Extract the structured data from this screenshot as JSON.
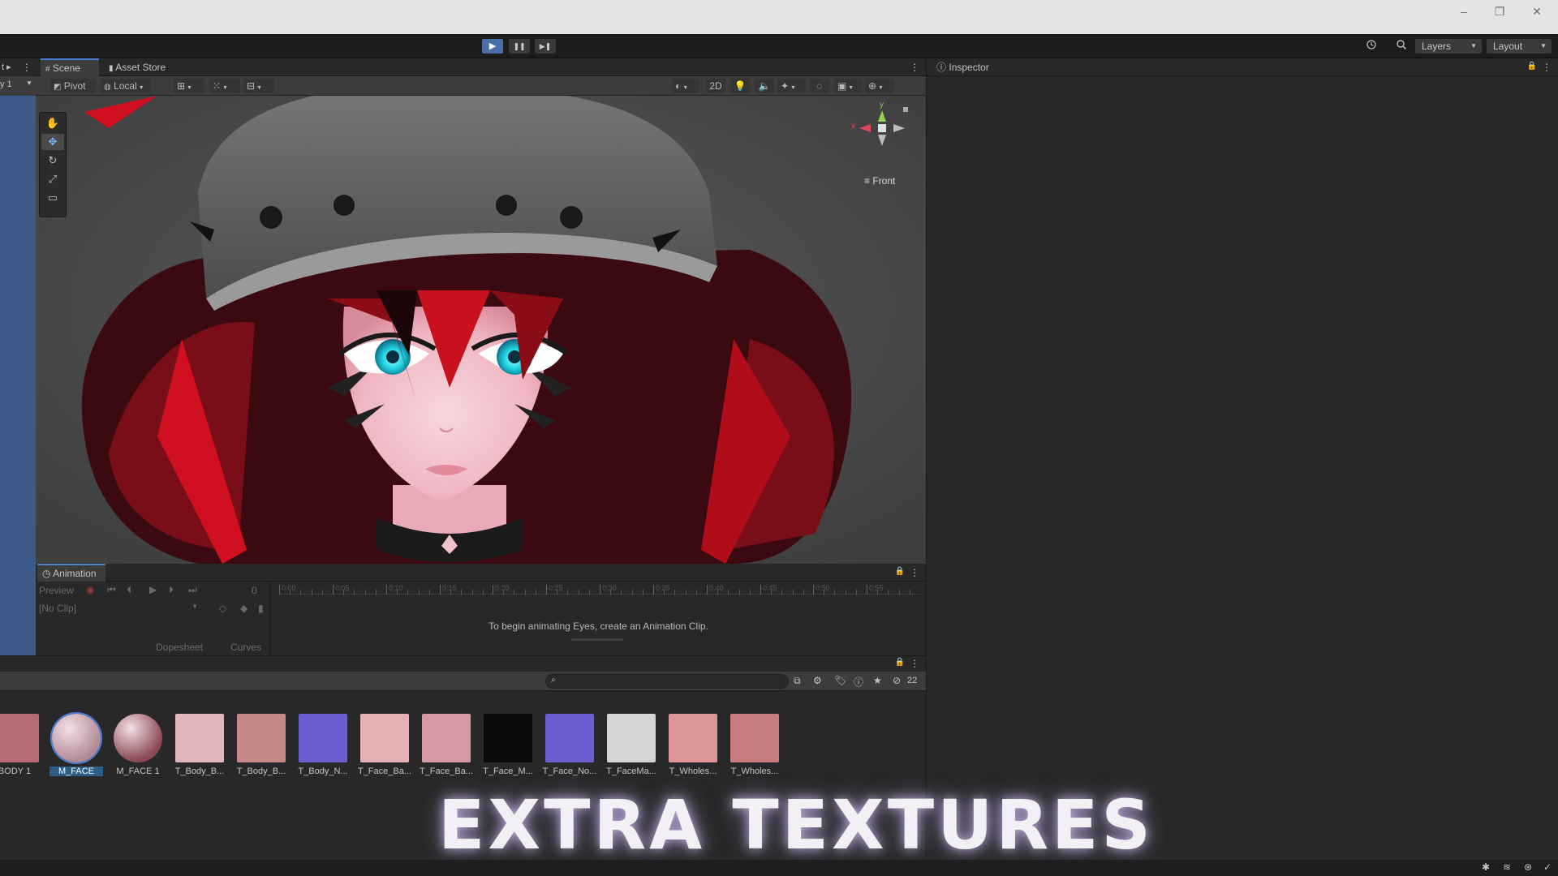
{
  "titlebar": {
    "minimize": "–",
    "maximize": "❐",
    "close": "✕"
  },
  "toolbar": {
    "play": "▶",
    "pause": "❚❚",
    "step": "▶❚",
    "history_icon": "history-icon",
    "search_icon": "search-icon",
    "layers_label": "Layers",
    "layout_label": "Layout"
  },
  "left_stub": {
    "label_top": "t ▸",
    "label_row": "y 1"
  },
  "tabs": {
    "scene": "Scene",
    "asset_store": "Asset Store",
    "inspector": "Inspector",
    "animation": "Animation"
  },
  "scene_toolbar": {
    "pivot": "Pivot",
    "local": "Local",
    "mode_2d": "2D"
  },
  "scene_view": {
    "gizmo_y": "y",
    "gizmo_x": "x",
    "view_label": "Front"
  },
  "animation": {
    "preview_label": "Preview",
    "clip_dropdown": "[No Clip]",
    "frame_value": "0",
    "message": "To begin animating Eyes, create an Animation Clip.",
    "dopesheet": "Dopesheet",
    "curves": "Curves",
    "timeline_ticks": [
      "0:00",
      "0:05",
      "0:10",
      "0:15",
      "0:20",
      "0:25",
      "0:30",
      "0:35",
      "0:40",
      "0:45",
      "0:50",
      "0:55"
    ]
  },
  "project": {
    "search_placeholder": "",
    "hidden_count": "22",
    "assets": [
      {
        "label": "BODY 1",
        "color": "#b86a72"
      },
      {
        "label": "M_FACE",
        "color": "#b28a98"
      },
      {
        "label": "M_FACE 1",
        "color": "#8a4a52"
      },
      {
        "label": "T_Body_B...",
        "color": "#e0b8bc"
      },
      {
        "label": "T_Body_B...",
        "color": "#c48888"
      },
      {
        "label": "T_Body_N...",
        "color": "#6a5ed0"
      },
      {
        "label": "T_Face_Ba...",
        "color": "#e6b0b4"
      },
      {
        "label": "T_Face_Ba...",
        "color": "#d69aa2"
      },
      {
        "label": "T_Face_M...",
        "color": "#0a0a0a"
      },
      {
        "label": "T_Face_No...",
        "color": "#6a5ed0"
      },
      {
        "label": "T_FaceMa...",
        "color": "#d4d4d4"
      },
      {
        "label": "T_Wholes...",
        "color": "#dc9698"
      },
      {
        "label": "T_Wholes...",
        "color": "#c87c80"
      }
    ]
  },
  "overlay_caption": "EXTRA  TEXTURES",
  "colors": {
    "accent": "#4c7fd4",
    "play_active": "#4a6fa5",
    "left_strip": "#3b5a8a"
  }
}
